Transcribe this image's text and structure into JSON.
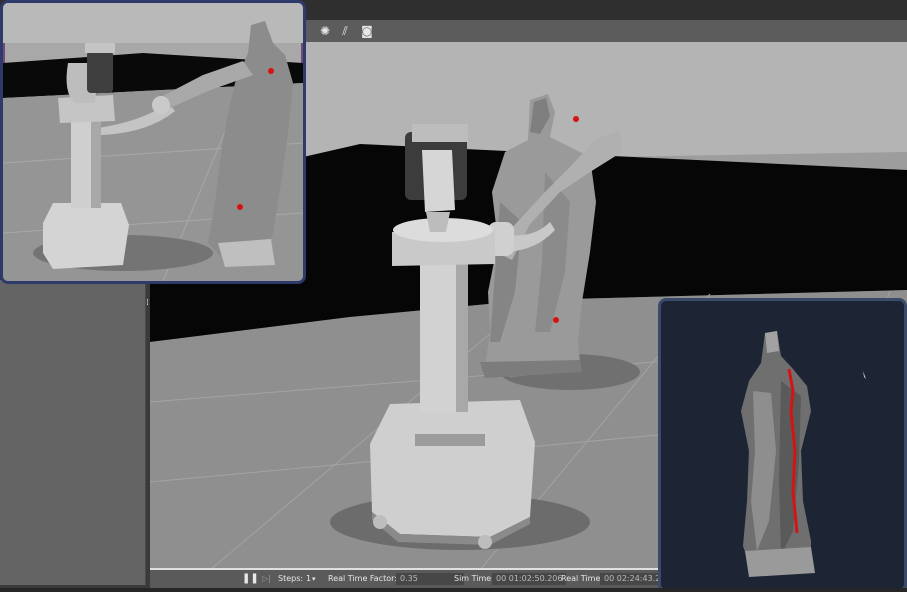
{
  "toolbar": {
    "tools": [
      {
        "icon": "light-spot-icon",
        "glyph": "✺"
      },
      {
        "icon": "light-dir-icon",
        "glyph": "⫽"
      },
      {
        "icon": "screenshot-icon",
        "glyph": "◙"
      }
    ]
  },
  "statusbar": {
    "pause_glyph": "❚❚",
    "step_glyph": "▷|",
    "steps_label": "Steps:",
    "steps_value": "1",
    "rtf_label": "Real Time Factor:",
    "rtf_value": "0.35",
    "sim_time_label": "Sim Time:",
    "sim_time_value": "00 01:02:50.206",
    "real_time_label": "Real Time:",
    "real_time_value": "00 02:24:43.2"
  },
  "colors": {
    "marker": "#d41414",
    "floor": "#8e8e8e",
    "void": "#050505",
    "sky": "#b3b3b3"
  }
}
